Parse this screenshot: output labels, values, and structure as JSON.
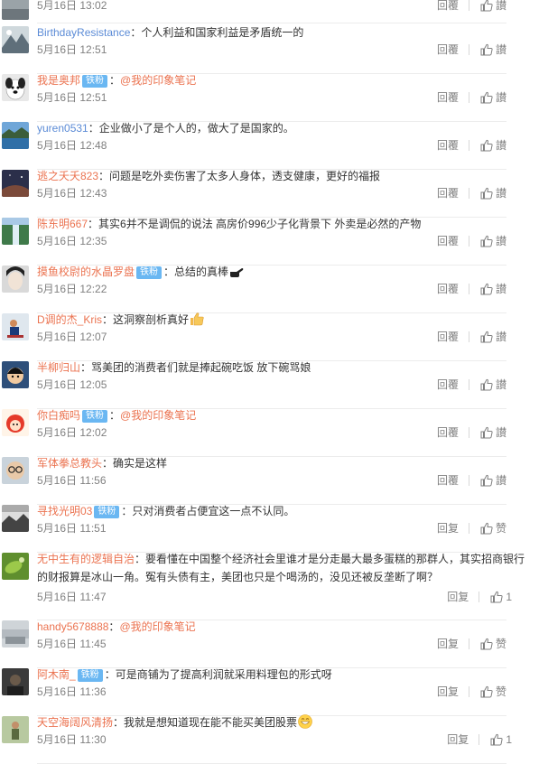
{
  "comments": [
    {
      "user": "",
      "user_style": "orange",
      "badge": "",
      "text": "",
      "mention": "",
      "emoji": "",
      "time": "5月16日 13:02",
      "reply": "回覆",
      "like": "讃",
      "avatar": "gray-avatar"
    },
    {
      "user": "BirthdayResistance",
      "user_style": "blue",
      "badge": "",
      "text": "：个人利益和国家利益是矛盾统一的",
      "mention": "",
      "emoji": "",
      "time": "5月16日 12:51",
      "reply": "回覆",
      "like": "讃",
      "avatar": "mountain-avatar"
    },
    {
      "user": "我是奥邦",
      "user_style": "orange",
      "badge": "铁粉",
      "text": "：",
      "mention": "@我的印象笔记",
      "emoji": "",
      "time": "5月16日 12:51",
      "reply": "回覆",
      "like": "讃",
      "avatar": "dog-avatar"
    },
    {
      "user": "yuren0531",
      "user_style": "blue",
      "badge": "",
      "text": "：企业做小了是个人的，做大了是国家的。",
      "mention": "",
      "emoji": "",
      "time": "5月16日 12:48",
      "reply": "回覆",
      "like": "讃",
      "avatar": "lake-avatar"
    },
    {
      "user": "逃之夭夭823",
      "user_style": "orange",
      "badge": "",
      "text": "：问题是吃外卖伤害了太多人身体，透支健康，更好的福报",
      "mention": "",
      "emoji": "",
      "time": "5月16日 12:43",
      "reply": "回覆",
      "like": "讃",
      "avatar": "night-avatar"
    },
    {
      "user": "陈东明667",
      "user_style": "orange",
      "badge": "",
      "text": "：其实6并不是调侃的说法 高房价996少子化背景下 外卖是必然的产物",
      "mention": "",
      "emoji": "",
      "time": "5月16日 12:35",
      "reply": "回覆",
      "like": "讃",
      "avatar": "waterfall-avatar"
    },
    {
      "user": "摸鱼校尉的水晶罗盘",
      "user_style": "orange",
      "badge": "铁粉",
      "text": "：总结的真棒",
      "mention": "",
      "emoji": "pointing-hand",
      "time": "5月16日 12:22",
      "reply": "回覆",
      "like": "讃",
      "avatar": "face-avatar"
    },
    {
      "user": "D调的杰_Kris",
      "user_style": "orange",
      "badge": "",
      "text": "：这洞察剖析真好",
      "mention": "",
      "emoji": "thumbs-up",
      "time": "5月16日 12:07",
      "reply": "回覆",
      "like": "讃",
      "avatar": "person-avatar"
    },
    {
      "user": "半柳归山",
      "user_style": "orange",
      "badge": "",
      "text": "：骂美团的消费者们就是捧起碗吃饭 放下碗骂娘",
      "mention": "",
      "emoji": "",
      "time": "5月16日 12:05",
      "reply": "回覆",
      "like": "讃",
      "avatar": "cartoon-avatar"
    },
    {
      "user": "你白痴吗",
      "user_style": "orange",
      "badge": "铁粉",
      "text": "：",
      "mention": "@我的印象笔记",
      "emoji": "",
      "time": "5月16日 12:02",
      "reply": "回覆",
      "like": "讃",
      "avatar": "red-cartoon-avatar"
    },
    {
      "user": "军体拳总教头",
      "user_style": "orange",
      "badge": "",
      "text": "：确实是这样",
      "mention": "",
      "emoji": "",
      "time": "5月16日 11:56",
      "reply": "回覆",
      "like": "讃",
      "avatar": "glasses-avatar"
    },
    {
      "user": "寻找光明03",
      "user_style": "orange",
      "badge": "铁粉",
      "text": "：只对消费者占便宜这一点不认同。",
      "mention": "",
      "emoji": "",
      "time": "5月16日 11:51",
      "reply": "回复",
      "like": "赞",
      "avatar": "bw-avatar"
    },
    {
      "user": "无中生有的逻辑自治",
      "user_style": "orange",
      "badge": "",
      "text": "：要看懂在中国整个经济社会里谁才是分走最大最多蛋糕的那群人，其实招商银行的财报算是冰山一角。冤有头债有主，美团也只是个喝汤的，没见还被反垄断了啊？",
      "mention": "",
      "emoji": "",
      "time": "5月16日 11:47",
      "reply": "回复",
      "like": "1",
      "avatar": "leaf-avatar"
    },
    {
      "user": "handy5678888",
      "user_style": "orange",
      "badge": "",
      "text": "：",
      "mention": "@我的印象笔记",
      "emoji": "",
      "time": "5月16日 11:45",
      "reply": "回复",
      "like": "赞",
      "avatar": "sky-avatar"
    },
    {
      "user": "阿木南_",
      "user_style": "orange",
      "badge": "铁粉",
      "text": "：可是商铺为了提高利润就采用料理包的形式呀",
      "mention": "",
      "emoji": "",
      "time": "5月16日 11:36",
      "reply": "回复",
      "like": "赞",
      "avatar": "dark-avatar"
    },
    {
      "user": "天空海阔风清扬",
      "user_style": "orange",
      "badge": "",
      "text": "：我就是想知道现在能不能买美团股票",
      "mention": "",
      "emoji": "grin",
      "time": "5月16日 11:30",
      "reply": "回复",
      "like": "1",
      "avatar": "outdoor-avatar"
    }
  ],
  "colors": {
    "username": "#eb7350",
    "username_alt": "#5b8bd6",
    "badge": "#6ab7f2",
    "meta": "#808080",
    "text": "#333333"
  }
}
